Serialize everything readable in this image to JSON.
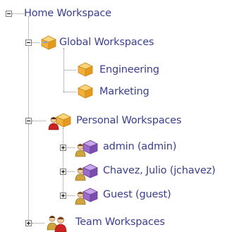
{
  "tree": {
    "root": {
      "label": "Home Workspace",
      "expanded": true
    },
    "global": {
      "label": "Global Workspaces",
      "expanded": true,
      "icon": "folder-box-icon",
      "children": [
        {
          "label": "Engineering",
          "icon": "folder-box-icon"
        },
        {
          "label": "Marketing",
          "icon": "folder-box-icon"
        }
      ]
    },
    "personal": {
      "label": "Personal Workspaces",
      "expanded": true,
      "icon": "personal-workspace-icon",
      "children": [
        {
          "label": "admin (admin)",
          "expanded": false,
          "icon": "user-workspace-icon"
        },
        {
          "label": "Chavez, Julio (jchavez)",
          "expanded": false,
          "icon": "user-workspace-icon"
        },
        {
          "label": "Guest (guest)",
          "expanded": false,
          "icon": "user-workspace-icon"
        }
      ]
    },
    "team": {
      "label": "Team Workspaces",
      "expanded": false,
      "icon": "team-workspace-icon"
    }
  },
  "colors": {
    "text": "#3b3f8c",
    "connector": "#8a8a8a",
    "box_front": "#f2b03c",
    "box_top": "#f8d47a",
    "user_body": "#cc2222",
    "purple_box": "#9a6cc8"
  }
}
